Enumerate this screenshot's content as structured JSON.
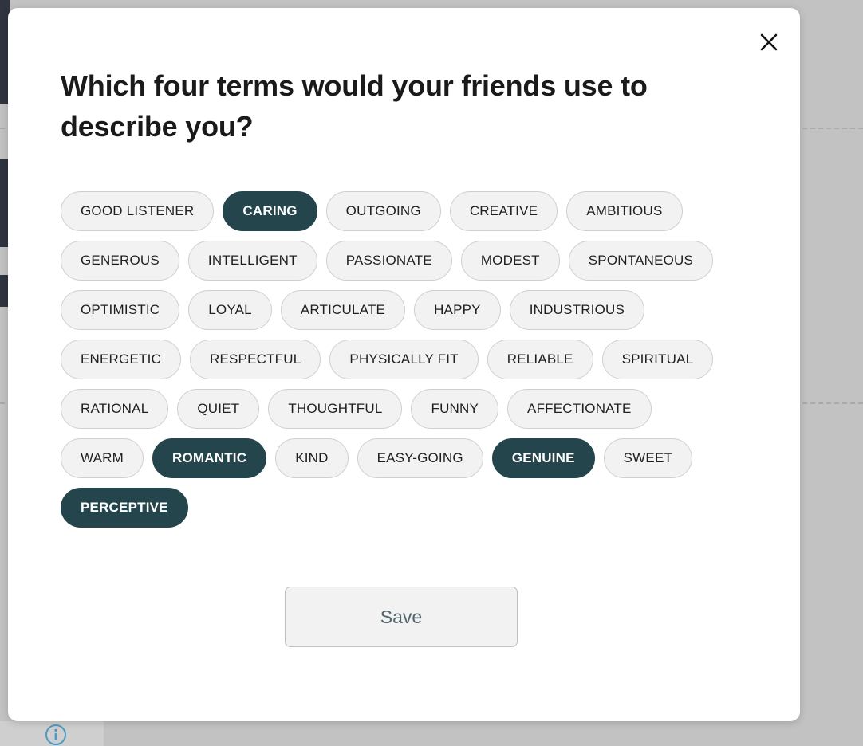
{
  "modal": {
    "title": "Which four terms would your friends use to describe you?",
    "close_label": "×",
    "save_label": "Save"
  },
  "icons": {
    "close": "close-icon",
    "info": "info-icon"
  },
  "colors": {
    "selected_chip_bg": "#24454c",
    "selected_chip_text": "#ffffff",
    "unselected_chip_bg": "#f2f2f2",
    "unselected_chip_border": "#cfcfcf",
    "unselected_chip_text": "#1f1f1f",
    "save_text": "#53656d",
    "page_background": "#c2c2c2",
    "info_icon": "#4a9bc4",
    "rail": "#2f3440"
  },
  "chip_rows": [
    [
      {
        "label": "GOOD LISTENER",
        "selected": false
      },
      {
        "label": "CARING",
        "selected": true
      },
      {
        "label": "OUTGOING",
        "selected": false
      },
      {
        "label": "CREATIVE",
        "selected": false
      },
      {
        "label": "AMBITIOUS",
        "selected": false
      }
    ],
    [
      {
        "label": "GENEROUS",
        "selected": false
      },
      {
        "label": "INTELLIGENT",
        "selected": false
      },
      {
        "label": "PASSIONATE",
        "selected": false
      },
      {
        "label": "MODEST",
        "selected": false
      },
      {
        "label": "SPONTANEOUS",
        "selected": false
      }
    ],
    [
      {
        "label": "OPTIMISTIC",
        "selected": false
      },
      {
        "label": "LOYAL",
        "selected": false
      },
      {
        "label": "ARTICULATE",
        "selected": false
      },
      {
        "label": "HAPPY",
        "selected": false
      },
      {
        "label": "INDUSTRIOUS",
        "selected": false
      }
    ],
    [
      {
        "label": "ENERGETIC",
        "selected": false
      },
      {
        "label": "RESPECTFUL",
        "selected": false
      },
      {
        "label": "PHYSICALLY FIT",
        "selected": false
      },
      {
        "label": "RELIABLE",
        "selected": false
      },
      {
        "label": "SPIRITUAL",
        "selected": false
      }
    ],
    [
      {
        "label": "RATIONAL",
        "selected": false
      },
      {
        "label": "QUIET",
        "selected": false
      },
      {
        "label": "THOUGHTFUL",
        "selected": false
      },
      {
        "label": "FUNNY",
        "selected": false
      },
      {
        "label": "AFFECTIONATE",
        "selected": false
      }
    ],
    [
      {
        "label": "WARM",
        "selected": false
      },
      {
        "label": "ROMANTIC",
        "selected": true
      },
      {
        "label": "KIND",
        "selected": false
      },
      {
        "label": "EASY-GOING",
        "selected": false
      },
      {
        "label": "GENUINE",
        "selected": true
      },
      {
        "label": "SWEET",
        "selected": false
      }
    ],
    [
      {
        "label": "PERCEPTIVE",
        "selected": true
      }
    ]
  ]
}
